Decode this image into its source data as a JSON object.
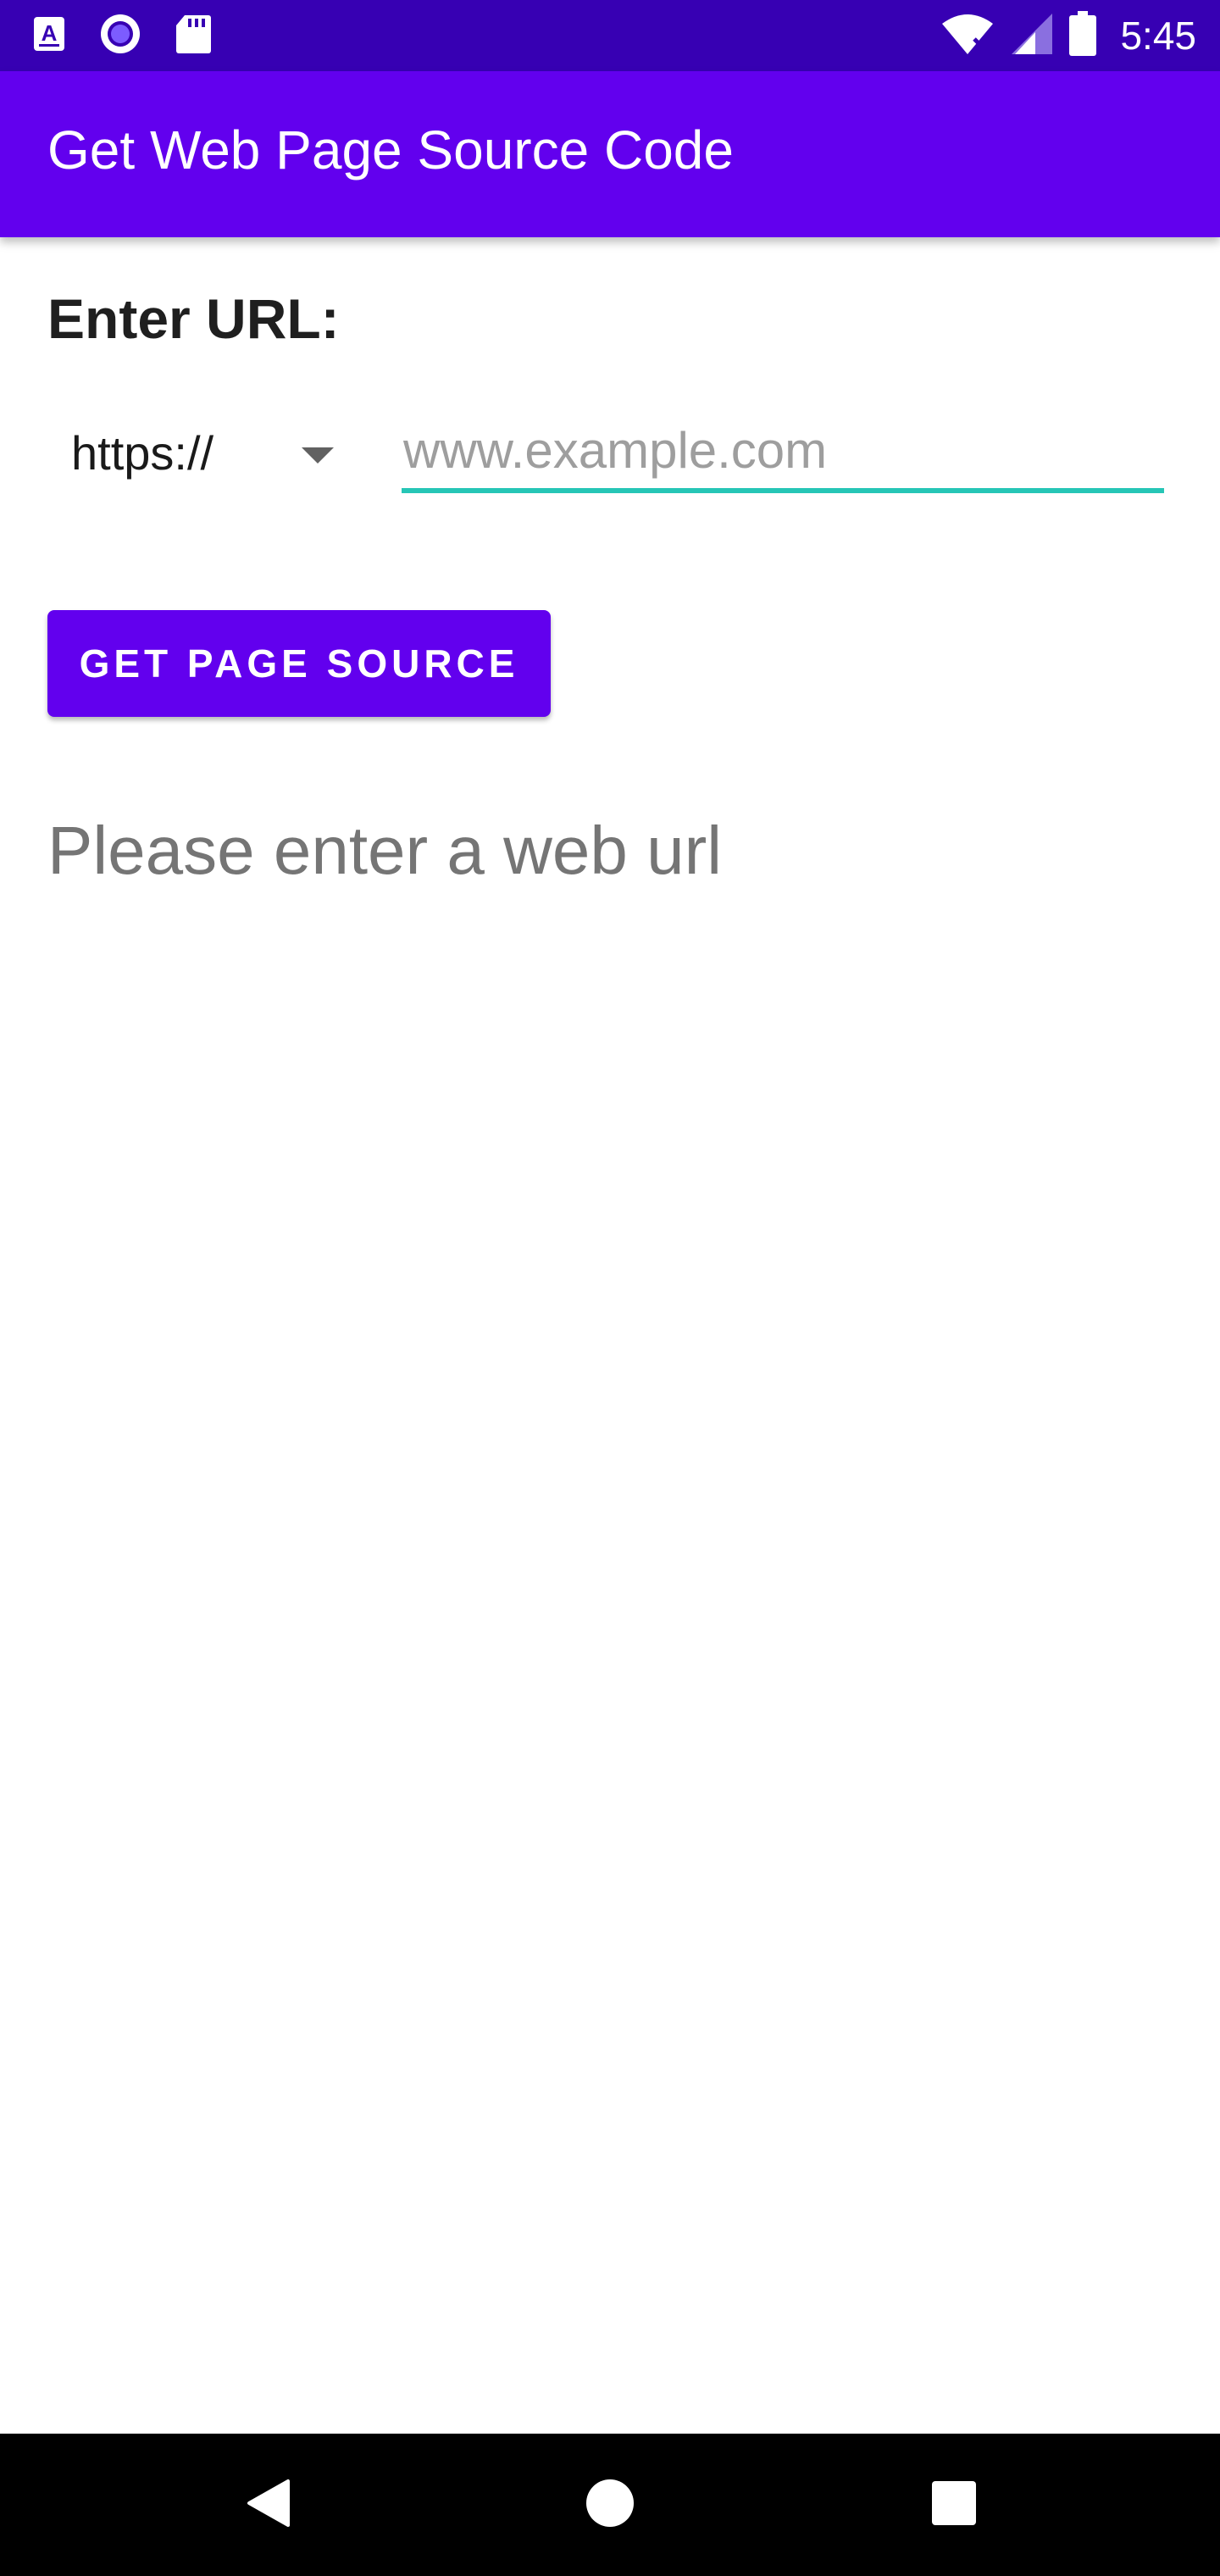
{
  "status_bar": {
    "time": "5:45",
    "left_icons": [
      "text-a-icon",
      "circle-record-icon",
      "sd-card-icon"
    ],
    "right_icons": [
      "wifi-icon",
      "signal-icon",
      "battery-icon"
    ],
    "background": "#3700b3"
  },
  "app_bar": {
    "title": "Get Web Page Source Code",
    "background": "#6200ee"
  },
  "form": {
    "url_label": "Enter URL:",
    "protocol_selected": "https://",
    "url_placeholder": "www.example.com",
    "url_value": "",
    "underline_color": "#26c6b6"
  },
  "actions": {
    "get_source_label": "GET PAGE SOURCE",
    "button_color": "#6200ee"
  },
  "result": {
    "message": "Please enter a web url"
  },
  "nav_bar": {
    "buttons": [
      "back-icon",
      "home-icon",
      "recents-icon"
    ]
  }
}
